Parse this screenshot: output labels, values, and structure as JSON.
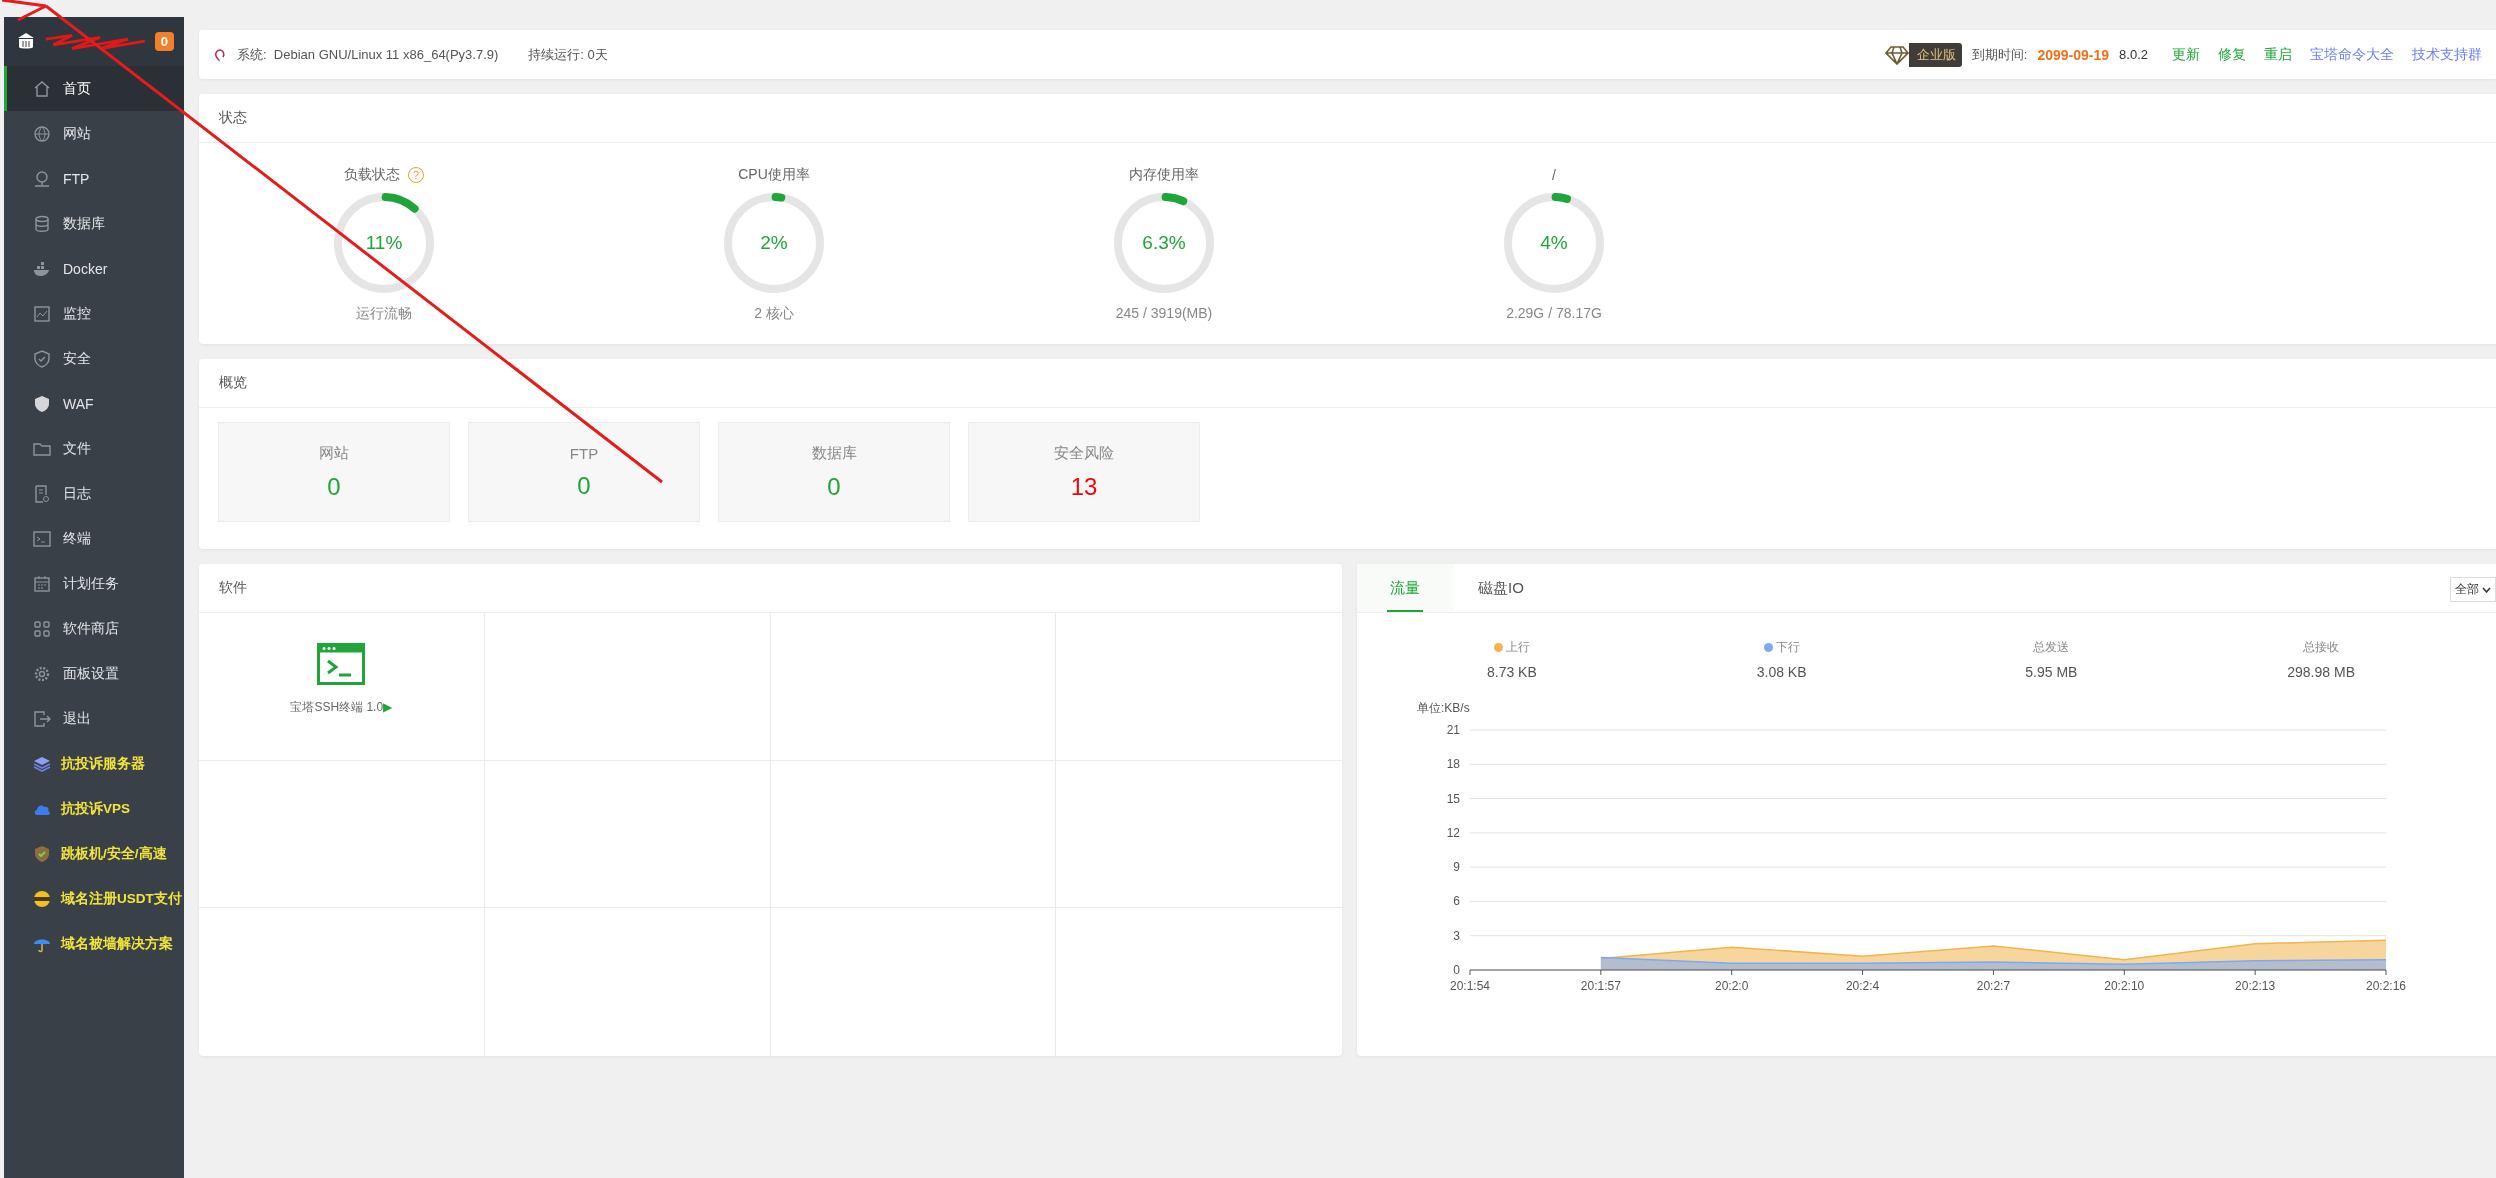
{
  "sidebar": {
    "badge": "0",
    "items": [
      {
        "label": "首页",
        "kind": "nav",
        "selected": true
      },
      {
        "label": "网站",
        "kind": "nav",
        "selected": false
      },
      {
        "label": "FTP",
        "kind": "nav",
        "selected": false
      },
      {
        "label": "数据库",
        "kind": "nav",
        "selected": false
      },
      {
        "label": "Docker",
        "kind": "nav",
        "selected": false
      },
      {
        "label": "监控",
        "kind": "nav",
        "selected": false
      },
      {
        "label": "安全",
        "kind": "nav",
        "selected": false
      },
      {
        "label": "WAF",
        "kind": "nav",
        "selected": false
      },
      {
        "label": "文件",
        "kind": "nav",
        "selected": false
      },
      {
        "label": "日志",
        "kind": "nav",
        "selected": false
      },
      {
        "label": "终端",
        "kind": "nav",
        "selected": false
      },
      {
        "label": "计划任务",
        "kind": "nav",
        "selected": false
      },
      {
        "label": "软件商店",
        "kind": "nav",
        "selected": false
      },
      {
        "label": "面板设置",
        "kind": "nav",
        "selected": false
      },
      {
        "label": "退出",
        "kind": "nav",
        "selected": false
      },
      {
        "label": "抗投诉服务器",
        "kind": "promo",
        "selected": false
      },
      {
        "label": "抗投诉VPS",
        "kind": "promo",
        "selected": false
      },
      {
        "label": "跳板机/安全/高速",
        "kind": "promo",
        "selected": false
      },
      {
        "label": "域名注册USDT支付",
        "kind": "promo",
        "selected": false
      },
      {
        "label": "域名被墙解决方案",
        "kind": "promo",
        "selected": false
      }
    ]
  },
  "top_bar": {
    "system_label": "系统:",
    "system_value": "Debian GNU/Linux 11 x86_64(Py3.7.9)",
    "uptime": "持续运行: 0天",
    "edition": "企业版",
    "expiry_label": "到期时间:",
    "expiry_date": "2099-09-19",
    "version": "8.0.2",
    "links": [
      {
        "label": "更新",
        "kind": "action"
      },
      {
        "label": "修复",
        "kind": "action"
      },
      {
        "label": "重启",
        "kind": "action"
      },
      {
        "label": "宝塔命令大全",
        "kind": "help"
      },
      {
        "label": "技术支持群",
        "kind": "help"
      }
    ]
  },
  "status": {
    "title": "状态",
    "gauges": [
      {
        "label": "负载状态",
        "help": "?",
        "value": "11%",
        "level": 0.11,
        "caption": "运行流畅"
      },
      {
        "label": "CPU使用率",
        "value": "2%",
        "level": 0.02,
        "caption": "2 核心"
      },
      {
        "label": "内存使用率",
        "value": "6.3%",
        "level": 0.063,
        "caption": "245 / 3919(MB)"
      },
      {
        "label": "/",
        "value": "4%",
        "level": 0.04,
        "caption": "2.29G / 78.17G"
      }
    ]
  },
  "overview": {
    "title": "概览",
    "items": [
      {
        "label": "网站",
        "value": "0",
        "color": "#20a53a"
      },
      {
        "label": "FTP",
        "value": "0",
        "color": "#20a53a"
      },
      {
        "label": "数据库",
        "value": "0",
        "color": "#20a53a"
      },
      {
        "label": "安全风险",
        "value": "13",
        "color": "#ef0808"
      }
    ]
  },
  "software": {
    "title": "软件",
    "items": [
      {
        "name": "宝塔SSH终端 1.0",
        "arrow": "▶"
      }
    ]
  },
  "traffic": {
    "tabs": [
      {
        "label": "流量",
        "selected": true
      },
      {
        "label": "磁盘IO",
        "selected": false
      }
    ],
    "select": "全部",
    "stats": [
      {
        "value": "8.73 KB"
      },
      {
        "value": "3.08 KB"
      },
      {
        "label": "总发送",
        "value": "5.95 MB"
      },
      {
        "label": "总接收",
        "value": "298.98 MB"
      }
    ],
    "chart_data": {
      "type": "area",
      "ylabel": "单位:KB/s",
      "categories": [
        "20:1:54",
        "20:1:57",
        "20:2:0",
        "20:2:4",
        "20:2:7",
        "20:2:10",
        "20:2:13",
        "20:2:16"
      ],
      "series": [
        {
          "name": "上行",
          "color": "#f0b54f",
          "values": [
            null,
            1.0,
            2.0,
            1.2,
            2.1,
            0.9,
            2.3,
            2.6
          ]
        },
        {
          "name": "下行",
          "color": "#7ca9f5",
          "values": [
            null,
            1.1,
            0.6,
            0.6,
            0.7,
            0.5,
            0.8,
            0.9
          ]
        }
      ],
      "grid": true,
      "ylim": [
        0,
        21
      ],
      "yticks": [
        0,
        3,
        6,
        9,
        12,
        15,
        18,
        21
      ]
    }
  }
}
